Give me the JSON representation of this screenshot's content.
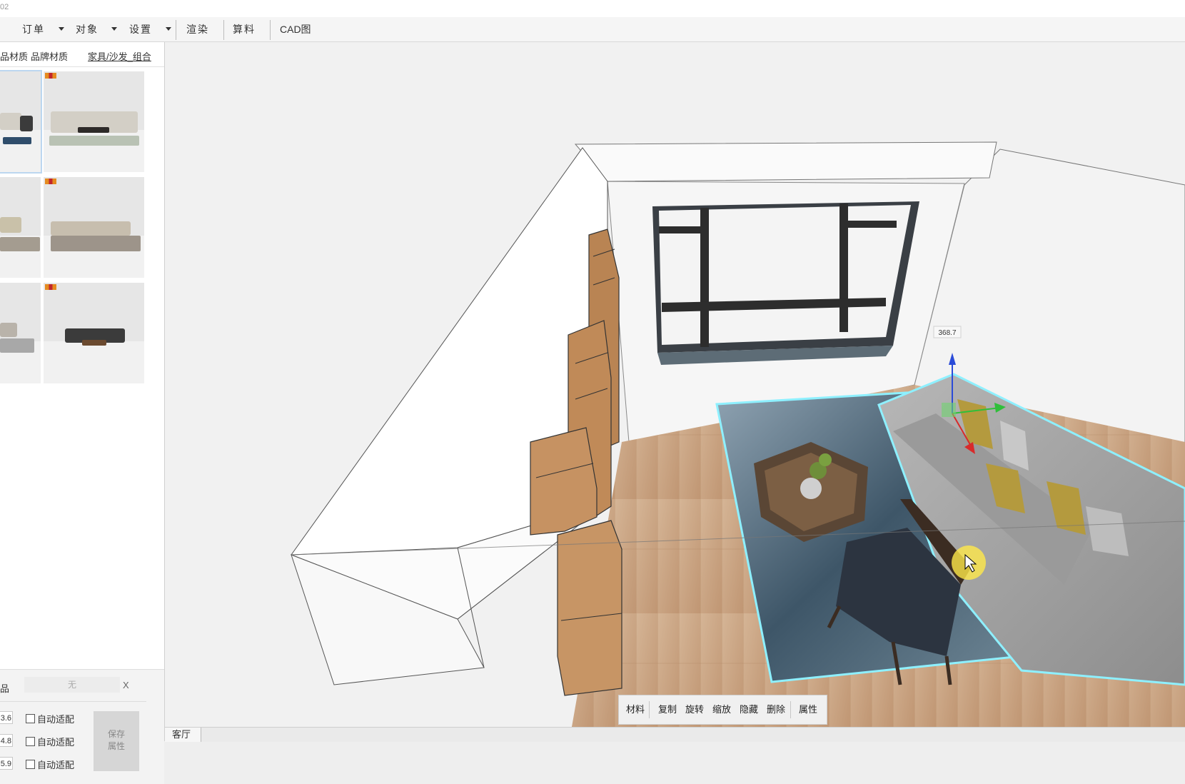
{
  "titlebar": {
    "title": "02"
  },
  "menu": {
    "order": "订单",
    "object": "对象",
    "settings": "设置",
    "render": "渲染",
    "calc": "算料",
    "cad": "CAD图"
  },
  "sidebar": {
    "tabs": {
      "tab1": "品材质",
      "tab2": "品牌材质",
      "breadcrumb": "家具/沙发_组合"
    },
    "thumbnails": 6
  },
  "props": {
    "label": "品",
    "material_value": "无",
    "close": "X",
    "dims": [
      "3.6",
      "4.8",
      "5.9"
    ],
    "auto_fit": "自动适配",
    "save_line1": "保存",
    "save_line2": "属性"
  },
  "viewport": {
    "dimension_label": "368.7"
  },
  "toolbar": {
    "material": "材料",
    "copy": "复制",
    "rotate": "旋转",
    "scale": "缩放",
    "hide": "隐藏",
    "delete": "删除",
    "properties": "属性"
  },
  "bottom": {
    "room_tab": "客厅"
  },
  "colors": {
    "selection": "#8ef0ff",
    "floor": "#c9a27d",
    "cabinet": "#c08a58",
    "window_frame": "#333333"
  }
}
